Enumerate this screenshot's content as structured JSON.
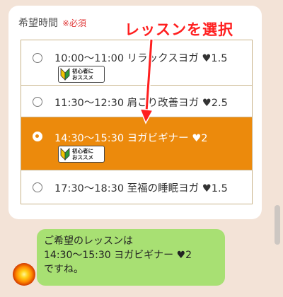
{
  "form": {
    "title": "希望時間",
    "required": "※必須",
    "callout": "レッスンを選択",
    "badge_line1": "初心者に",
    "badge_line2": "おススメ",
    "options": [
      {
        "label": "10:00〜11:00 リラックスヨガ ♥1.5",
        "beginner": true,
        "selected": false
      },
      {
        "label": "11:30〜12:30 肩こり改善ヨガ ♥2.5",
        "beginner": false,
        "selected": false
      },
      {
        "label": "14:30〜15:30 ヨガビギナー ♥2",
        "beginner": true,
        "selected": true
      },
      {
        "label": "17:30〜18:30 至福の睡眠ヨガ ♥1.5",
        "beginner": false,
        "selected": false
      }
    ]
  },
  "chat": {
    "message_lines": [
      "ご希望のレッスンは",
      "14:30〜15:30 ヨガビギナー ♥2",
      "ですね。"
    ]
  },
  "colors": {
    "selected_bg": "#ec8a0c",
    "bubble_bg": "#a8e073",
    "callout": "#ff1f1f",
    "background": "#f3e3d7"
  },
  "icons": {
    "beginner_badge": "beginner-leaf-icon",
    "avatar": "sun-avatar-icon"
  }
}
